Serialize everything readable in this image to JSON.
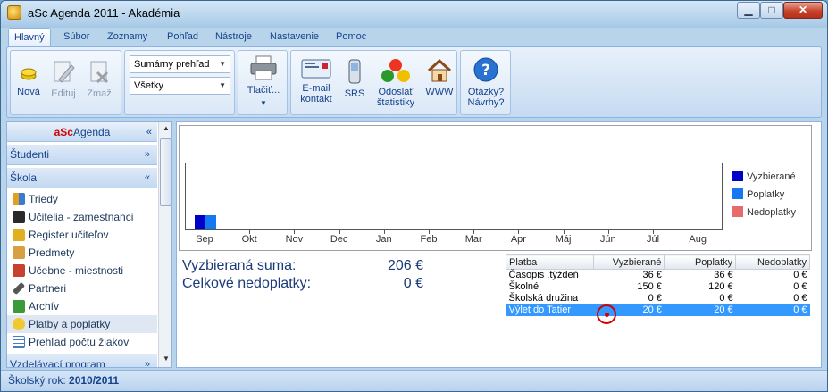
{
  "window": {
    "title": "aSc Agenda 2011 - Akadémia",
    "minimize": "▁",
    "maximize": "□",
    "close": "✕"
  },
  "ribbon_tabs": [
    "Hlavný",
    "Súbor",
    "Zoznamy",
    "Pohľad",
    "Nástroje",
    "Nastavenie",
    "Pomoc"
  ],
  "ribbon": {
    "new_label": "Nová",
    "edit_label": "Edituj",
    "delete_label": "Zmaž",
    "view_select": "Sumárny prehľad",
    "filter_select": "Všetky",
    "print_label": "Tlačiť...",
    "email_label_1": "E-mail",
    "email_label_2": "kontakt",
    "srs_label": "SRS",
    "stats_label_1": "Odoslať",
    "stats_label_2": "štatistiky",
    "www_label": "WWW",
    "help_label_1": "Otázky?",
    "help_label_2": "Návrhy?"
  },
  "sidebar": {
    "header_brand": "aSc",
    "header_rest": "Agenda",
    "sections": {
      "students": "Študenti",
      "school": "Škola",
      "program": "Vzdelávací program"
    },
    "items": [
      {
        "label": "Triedy",
        "icon": "group-icon"
      },
      {
        "label": "Učitelia - zamestnanci",
        "icon": "teacher-icon"
      },
      {
        "label": "Register učiteľov",
        "icon": "lock-icon"
      },
      {
        "label": "Predmety",
        "icon": "book-icon"
      },
      {
        "label": "Učebne - miestnosti",
        "icon": "house-icon"
      },
      {
        "label": "Partneri",
        "icon": "pen-icon"
      },
      {
        "label": "Archív",
        "icon": "archive-icon"
      },
      {
        "label": "Platby a poplatky",
        "icon": "coins-icon"
      },
      {
        "label": "Prehľad počtu žiakov",
        "icon": "table-icon"
      }
    ]
  },
  "chart_data": {
    "type": "bar",
    "categories": [
      "Sep",
      "Okt",
      "Nov",
      "Dec",
      "Jan",
      "Feb",
      "Mar",
      "Apr",
      "Máj",
      "Jún",
      "Júl",
      "Aug"
    ],
    "series": [
      {
        "name": "Vyzbierané",
        "color": "#0000c8",
        "values": [
          206,
          0,
          0,
          0,
          0,
          0,
          0,
          0,
          0,
          0,
          0,
          0
        ]
      },
      {
        "name": "Poplatky",
        "color": "#1478f0",
        "values": [
          206,
          0,
          0,
          0,
          0,
          0,
          0,
          0,
          0,
          0,
          0,
          0
        ]
      },
      {
        "name": "Nedoplatky",
        "color": "#e86b6b",
        "values": [
          0,
          0,
          0,
          0,
          0,
          0,
          0,
          0,
          0,
          0,
          0,
          0
        ]
      }
    ],
    "ylim": [
      0,
      1000
    ],
    "legend": "right"
  },
  "summary": {
    "collected_label": "Vyzbieraná suma:",
    "collected_value": "206 €",
    "arrears_label": "Celkové nedoplatky:",
    "arrears_value": "0 €"
  },
  "payments_table": {
    "headers": [
      "Platba",
      "Vyzbierané",
      "Poplatky",
      "Nedoplatky"
    ],
    "rows": [
      [
        "Časopis .týždeň",
        "36 €",
        "36 €",
        "0 €"
      ],
      [
        "Školné",
        "150 €",
        "120 €",
        "0 €"
      ],
      [
        "Školská družina",
        "0 €",
        "0 €",
        "0 €"
      ],
      [
        "Výlet do Tatier",
        "20 €",
        "20 €",
        "0 €"
      ]
    ]
  },
  "statusbar": {
    "label": "Školský rok:",
    "value": "2010/2011"
  }
}
